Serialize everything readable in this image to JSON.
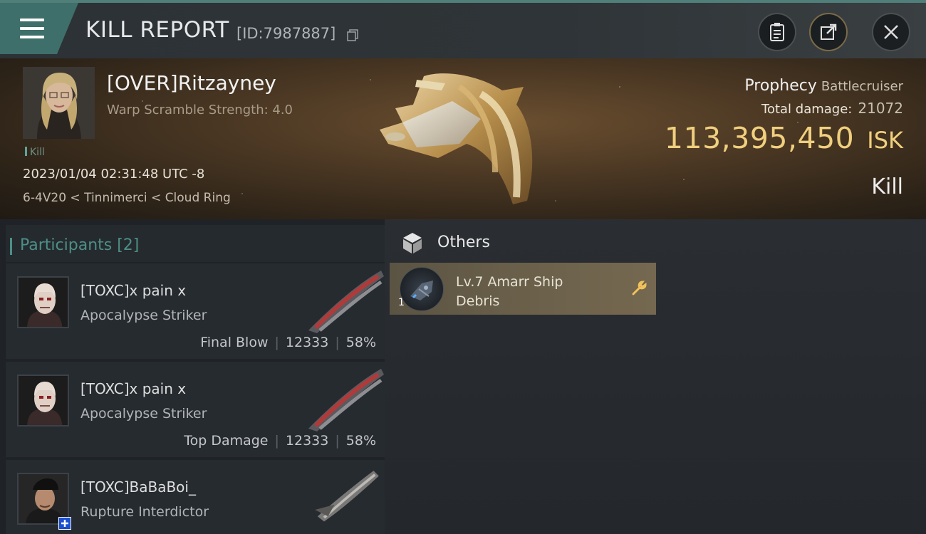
{
  "header": {
    "title": "KILL REPORT",
    "report_id": "[ID:7987887]"
  },
  "victim": {
    "name": "[OVER]Ritzayney",
    "warp_scramble": "Warp Scramble Strength: 4.0",
    "tag": "Kill",
    "datetime": "2023/01/04 02:31:48 UTC -8",
    "location": "6-4V20 < Tinnimerci < Cloud Ring",
    "ship_name": "Prophecy",
    "ship_class": "Battlecruiser",
    "total_damage_label": "Total damage:",
    "total_damage": "21072",
    "isk_amount": "113,395,450",
    "isk_unit": "ISK",
    "result": "Kill"
  },
  "participants": {
    "title": "Participants [2]",
    "rows": [
      {
        "name": "[TOXC]x pain x",
        "ship": "Apocalypse Striker",
        "role": "Final Blow",
        "damage": "12333",
        "percent": "58%"
      },
      {
        "name": "[TOXC]x pain x",
        "ship": "Apocalypse Striker",
        "role": "Top Damage",
        "damage": "12333",
        "percent": "58%"
      },
      {
        "name": "[TOXC]BaBaBoi_",
        "ship": "Rupture Interdictor"
      }
    ]
  },
  "others": {
    "title": "Others",
    "items": [
      {
        "name": "Lv.7 Amarr Ship Debris",
        "qty": "1"
      }
    ]
  },
  "colors": {
    "accent_teal": "#4d8f87",
    "isk_gold": "#f0cf7e",
    "item_card": "#6a604a"
  }
}
